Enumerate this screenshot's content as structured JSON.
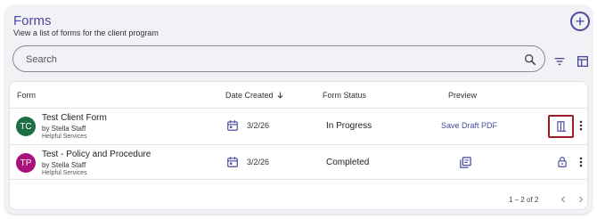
{
  "header": {
    "title": "Forms",
    "subtitle": "View a list of forms for the client program",
    "add_icon": "plus-circle-icon"
  },
  "search": {
    "placeholder": "Search",
    "value": "",
    "icon": "search-icon"
  },
  "toolbar": {
    "filter_icon": "filter-icon",
    "columns_icon": "table-columns-icon"
  },
  "table": {
    "headers": {
      "form": "Form",
      "date_created": "Date Created",
      "form_status": "Form Status",
      "preview": "Preview"
    },
    "sort_icon": "arrow-down-icon",
    "rows": [
      {
        "initials": "TC",
        "avatar_color": "#1e6e42",
        "name": "Test Client Form",
        "by": "by Stella Staff",
        "org": "Helpful Services",
        "date": "3/2/26",
        "status": "In Progress",
        "preview_text": "Save Draft PDF",
        "action_icon": "open-form-icon",
        "more_icon": "more-vertical-icon"
      },
      {
        "initials": "TP",
        "avatar_color": "#a8127a",
        "name": "Test - Policy and Procedure",
        "by": "by Stella Staff",
        "org": "Helpful Services",
        "date": "3/2/26",
        "status": "Completed",
        "preview_icon": "pdf-preview-icon",
        "action_icon": "lock-icon",
        "more_icon": "more-vertical-icon"
      }
    ]
  },
  "pagination": {
    "range": "1 – 2 of 2",
    "prev_icon": "chevron-left-icon",
    "next_icon": "chevron-right-icon"
  },
  "colors": {
    "accent": "#4b4a9e",
    "highlight_border": "#9b1c25",
    "panel_bg": "#f2f1f6"
  }
}
